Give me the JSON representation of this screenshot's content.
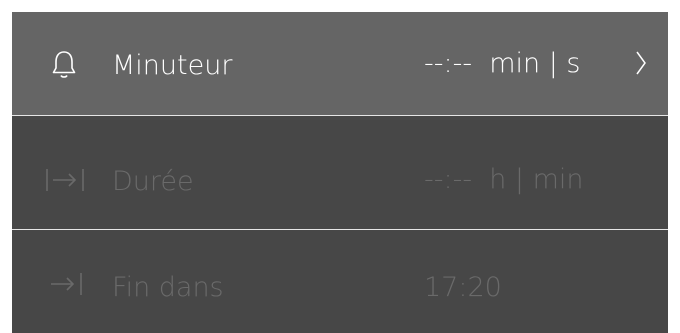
{
  "colors": {
    "selected_row_bg": "#656565",
    "row_bg": "#474747",
    "divider": "#e6e6e6",
    "active_text": "#ffffff",
    "disabled_text": "#6a6a6a"
  },
  "rows": [
    {
      "icon": "bell-icon",
      "label": "Minuteur",
      "value": "--:--  min | s",
      "chevron": "chevron-right-icon"
    },
    {
      "icon": "duration-icon",
      "label": "Durée",
      "value": "--:--  h | min"
    },
    {
      "icon": "end-in-icon",
      "label": "Fin dans",
      "value": "17:20"
    }
  ]
}
